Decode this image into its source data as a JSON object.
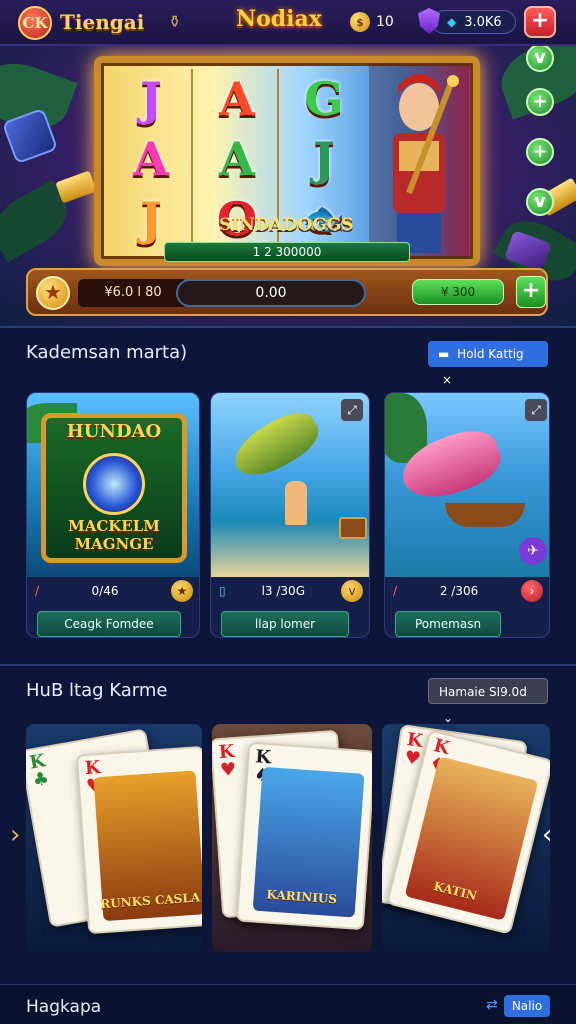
{
  "topbar": {
    "brand_badge": "CK",
    "brand_name": "Tiengai",
    "game_logo": "Nodiax",
    "coin_symbol": "$",
    "coin_count": "10",
    "balance": "3.0K6",
    "add_symbol": "+"
  },
  "slot": {
    "reel1": [
      "J",
      "A",
      "J"
    ],
    "reel2": [
      "A",
      "A",
      "O"
    ],
    "reel3": [
      "G",
      "J",
      ""
    ],
    "title": "SINDADOGGS",
    "jackpot": "1 2 300000",
    "bet": "¥6.0 l 80",
    "win": "0.00",
    "auto": "¥  300",
    "side_buttons": [
      "v",
      "+",
      "+",
      "v"
    ]
  },
  "section1": {
    "title": "Kademsan marta)",
    "filter": "Hold Kattig"
  },
  "games": [
    {
      "art_title": "HUNDAO",
      "art_subtitle": "MACKELM MAGNGE",
      "value": "0/46",
      "fav": "★",
      "button": "Ceagk Fomdee"
    },
    {
      "value": "l3 /30G",
      "fav": "v",
      "button": "llap lomer"
    },
    {
      "value": "2 /306",
      "fav": "›",
      "button": "Pomemasn"
    }
  ],
  "section2": {
    "title": "HuB ltag Karme",
    "filter": "Hamaie SI9.0d"
  },
  "cards": [
    {
      "rank": "K",
      "suit": "♣",
      "rank2": "K",
      "suit2": "♥",
      "caption": "RUNKS CASLA"
    },
    {
      "rank": "K",
      "suit": "♥",
      "rank2": "K",
      "suit2": "♠",
      "caption": "KARINIUS"
    },
    {
      "rank": "K",
      "suit": "♥",
      "rank2": "K",
      "suit2": "♦",
      "caption": "KATIN"
    }
  ],
  "bottom": {
    "title": "Hagkapa",
    "button": "Nalio"
  },
  "colors": {
    "background": "#0d1638",
    "accent_gold": "#ffd45a",
    "accent_green": "#1c8e22",
    "accent_red": "#c51d2a",
    "accent_blue": "#2f6ee0"
  }
}
